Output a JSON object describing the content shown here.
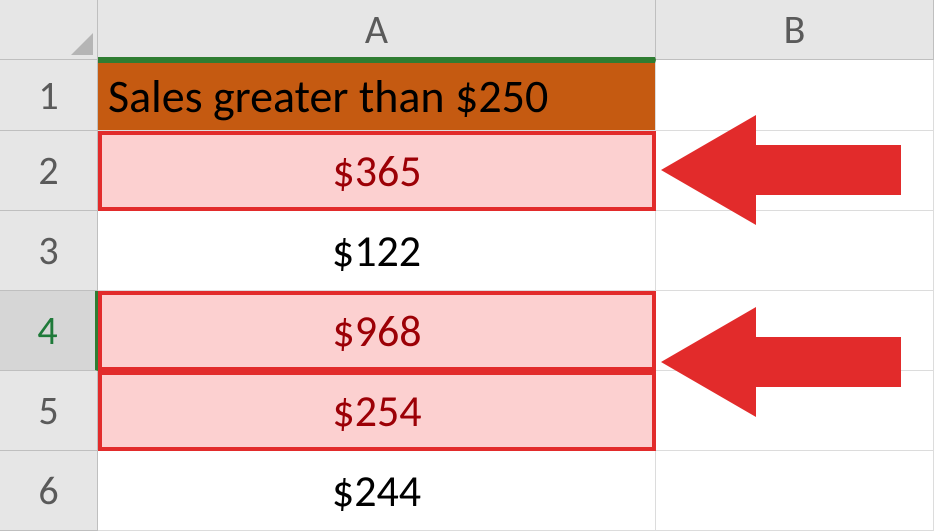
{
  "columns": {
    "A": "A",
    "B": "B"
  },
  "row_labels": [
    "1",
    "2",
    "3",
    "4",
    "5",
    "6"
  ],
  "cells": {
    "A1": "Sales greater than $250",
    "A2": "$365",
    "A3": "$122",
    "A4": "$968",
    "A5": "$254",
    "A6": "$244"
  },
  "highlighted_rows": [
    2,
    4,
    5
  ],
  "selected_row_header": 4,
  "annotation": "arrow-left",
  "chart_data": {
    "type": "table",
    "title": "Sales greater than $250",
    "columns": [
      "Sales"
    ],
    "rows": [
      {
        "value": 365,
        "highlighted": true
      },
      {
        "value": 122,
        "highlighted": false
      },
      {
        "value": 968,
        "highlighted": true
      },
      {
        "value": 254,
        "highlighted": true
      },
      {
        "value": 244,
        "highlighted": false
      }
    ],
    "threshold": 250
  }
}
